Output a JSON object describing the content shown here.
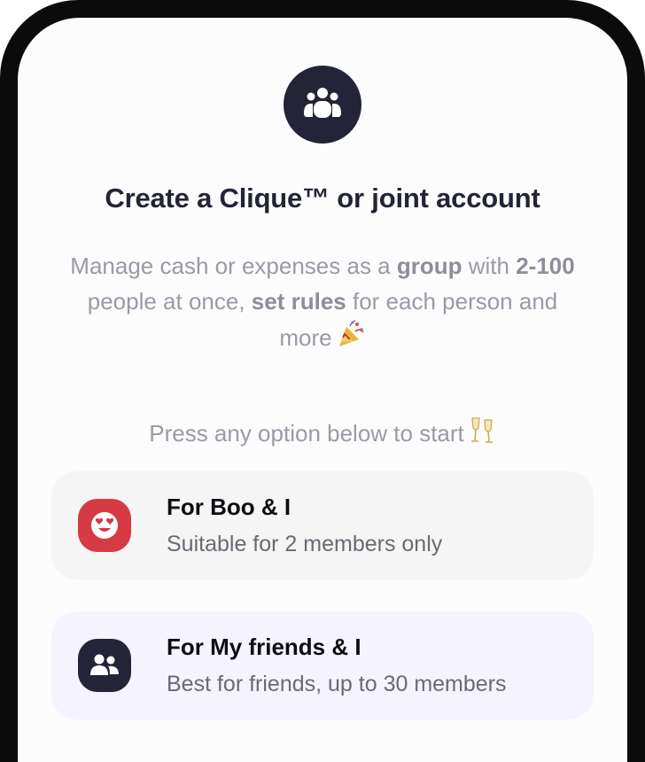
{
  "header": {
    "icon": "group-icon",
    "title": "Create a Clique™ or joint account"
  },
  "description": {
    "part1": "Manage cash or expenses as a ",
    "bold1": "group",
    "part2": " with ",
    "bold2": "2-100",
    "part3": " people at once, ",
    "bold3": "set rules",
    "part4": " for each person and more",
    "emoji": "party-popper-icon"
  },
  "instruction": {
    "text": "Press any option below to start",
    "emoji": "champagne-glasses-icon"
  },
  "options": [
    {
      "title": "For Boo & I",
      "subtitle": "Suitable for 2 members only",
      "icon": "heart-eyes-face-icon",
      "icon_bg": "#d63b45"
    },
    {
      "title": "For My friends & I",
      "subtitle": "Best for friends, up to 30 members",
      "icon": "friends-icon",
      "icon_bg": "#232437"
    }
  ],
  "colors": {
    "primary_dark": "#232437",
    "accent_red": "#d63b45",
    "muted_text": "#9a9aa6"
  }
}
